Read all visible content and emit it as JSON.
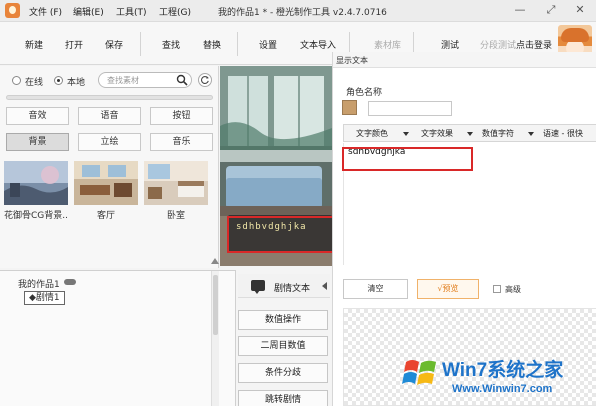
{
  "menu": {
    "file": "文件 (F)",
    "edit": "编辑(E)",
    "tools": "工具(T)",
    "project": "工程(G)",
    "window_title": "我的作品1 * - 橙光制作工具 v2.4.7.0716"
  },
  "window_controls": {
    "minimize": "—",
    "restore": "⤢",
    "close": "✕"
  },
  "toolbar": {
    "new": "新建",
    "open": "打开",
    "save": "保存",
    "find": "查找",
    "replace": "替换",
    "settings": "设置",
    "text_import": "文本导入",
    "asset_library": "素材库",
    "test": "测试",
    "segment_test": "分段测试",
    "login": "点击登录"
  },
  "left_panel": {
    "radio_online": "在线",
    "radio_local": "本地",
    "search_placeholder": "查找素材",
    "categories": [
      "音效",
      "语音",
      "按钮",
      "背景",
      "立绘",
      "音乐"
    ],
    "active_category": "背景",
    "thumbnails": [
      {
        "label": "花御骨CG背景..."
      },
      {
        "label": "客厅"
      },
      {
        "label": "卧室"
      }
    ]
  },
  "stage": {
    "dialogue_text": "sdhbvdghjka"
  },
  "tree": {
    "root": "我的作品1",
    "child": "◆剧情1"
  },
  "commands": {
    "header": "剧情文本",
    "buttons": [
      "数值操作",
      "二周目数值",
      "条件分歧",
      "跳转剧情"
    ]
  },
  "dialog": {
    "title": "显示文本",
    "character_name_label": "角色名称",
    "character_name_value": "",
    "swatch_color": "#c89e6c",
    "format_buttons": [
      "文字颜色",
      "文字效果",
      "数值字符",
      "语速 - 很快"
    ],
    "text_content": "sdhbvdghjka",
    "clear_button": "清空",
    "preview_button": "√预览",
    "advanced_label": "高级"
  },
  "watermark": {
    "brand": "Win7系统之家",
    "url": "Www.Winwin7.com"
  }
}
